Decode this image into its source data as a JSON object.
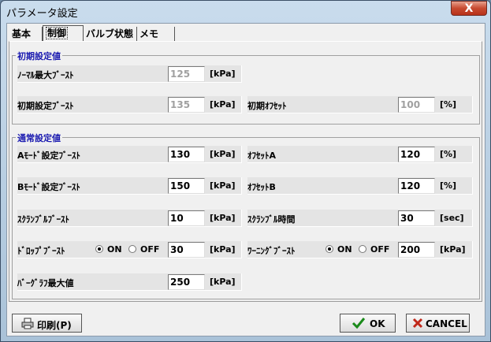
{
  "window": {
    "title": "パラメータ設定",
    "close_glyph": "X"
  },
  "tabs": [
    "基本",
    "制御",
    "バルブ状態",
    "メモ"
  ],
  "groups": {
    "initial": "初期設定値",
    "normal": "通常設定値"
  },
  "initial": {
    "normal_max_boost": {
      "label": "ﾉｰﾏﾙ最大ﾌﾞｰｽﾄ",
      "value": "125",
      "unit": "[kPa]"
    },
    "initial_boost": {
      "label": "初期設定ﾌﾞｰｽﾄ",
      "value": "135",
      "unit": "[kPa]"
    },
    "initial_offset": {
      "label": "初期ｵﾌｾｯﾄ",
      "value": "100",
      "unit": "[%]"
    }
  },
  "normal": {
    "a_mode_boost": {
      "label": "Aﾓｰﾄﾞ設定ﾌﾞｰｽﾄ",
      "value": "130",
      "unit": "[kPa]"
    },
    "offset_a": {
      "label": "ｵﾌｾｯﾄA",
      "value": "120",
      "unit": "[%]"
    },
    "b_mode_boost": {
      "label": "Bﾓｰﾄﾞ設定ﾌﾞｰｽﾄ",
      "value": "150",
      "unit": "[kPa]"
    },
    "offset_b": {
      "label": "ｵﾌｾｯﾄB",
      "value": "120",
      "unit": "[%]"
    },
    "scramble_boost": {
      "label": "ｽｸﾗﾝﾌﾞﾙﾌﾞｰｽﾄ",
      "value": "10",
      "unit": "[kPa]"
    },
    "scramble_time": {
      "label": "ｽｸﾗﾝﾌﾞﾙ時間",
      "value": "30",
      "unit": "[sec]"
    },
    "drop_boost": {
      "label": "ﾄﾞﾛｯﾌﾟﾌﾞｰｽﾄ",
      "on": "ON",
      "off": "OFF",
      "value": "30",
      "unit": "[kPa]"
    },
    "warning_boost": {
      "label": "ﾜｰﾆﾝｸﾞﾌﾞｰｽﾄ",
      "on": "ON",
      "off": "OFF",
      "value": "200",
      "unit": "[kPa]"
    },
    "bargraph_max": {
      "label": "ﾊﾞｰｸﾞﾗﾌ最大値",
      "value": "250",
      "unit": "[kPa]"
    }
  },
  "buttons": {
    "print": "印刷(P)",
    "ok": "OK",
    "cancel": "CANCEL"
  }
}
